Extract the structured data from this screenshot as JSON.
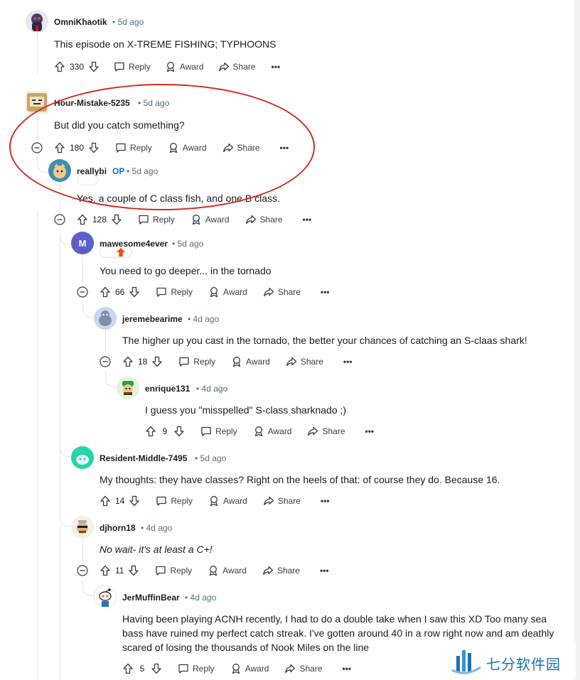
{
  "comments": [
    {
      "author": "OmniKhaotik",
      "meta": "• 5d ago",
      "body": "This episode on X-TREME FISHING; TYPHOONS",
      "votes": "330",
      "reply": "Reply",
      "award": "Award",
      "share": "Share"
    },
    {
      "author": "Hour-Mistake-5235",
      "meta": "• 5d ago",
      "body": "But did you catch something?",
      "votes": "180",
      "reply": "Reply",
      "award": "Award",
      "share": "Share"
    },
    {
      "author": "reallybi",
      "op": "OP",
      "meta": "• 5d ago",
      "body": "Yes, a couple of C class fish, and one B class.",
      "votes": "128",
      "reply": "Reply",
      "award": "Award",
      "share": "Share"
    },
    {
      "author": "mawesome4ever",
      "avatar_letter": "M",
      "meta": "• 5d ago",
      "body": "You need to go deeper... in the tornado",
      "votes": "66",
      "reply": "Reply",
      "award": "Award",
      "share": "Share"
    },
    {
      "author": "jeremebearime",
      "meta": "• 4d ago",
      "body": "The higher up you cast in the tornado, the better your chances of catching an S-claas shark!",
      "votes": "18",
      "reply": "Reply",
      "award": "Award",
      "share": "Share"
    },
    {
      "author": "enrique131",
      "meta": "• 4d ago",
      "body": "I guess you \"misspelled\" S-class sharknado ;)",
      "votes": "9",
      "reply": "Reply",
      "award": "Award",
      "share": "Share"
    },
    {
      "author": "Resident-Middle-7495",
      "meta": "• 5d ago",
      "body": "My thoughts: they have classes? Right on the heels of that: of course they do.  Because 16.",
      "votes": "14",
      "reply": "Reply",
      "award": "Award",
      "share": "Share"
    },
    {
      "author": "djhorn18",
      "meta": "• 4d ago",
      "body": "No wait- it's at least a C+!",
      "votes": "11",
      "reply": "Reply",
      "award": "Award",
      "share": "Share"
    },
    {
      "author": "JerMuffinBear",
      "meta": "• 4d ago",
      "body": "Having been playing ACNH recently, I had to do a double take when I saw this XD Too many sea bass have ruined my perfect catch streak. I've gotten around 40 in a row right now and am deathly scared of losing the thousands of Nook Miles on the line",
      "votes": "5",
      "reply": "Reply",
      "award": "Award",
      "share": "Share"
    }
  ],
  "more_label": "•••",
  "watermark": "七分软件园",
  "colors": {
    "accent": "#0079d3",
    "highlight": "#d32a20",
    "meta": "#576f76",
    "thread": "#e0e4e6"
  }
}
